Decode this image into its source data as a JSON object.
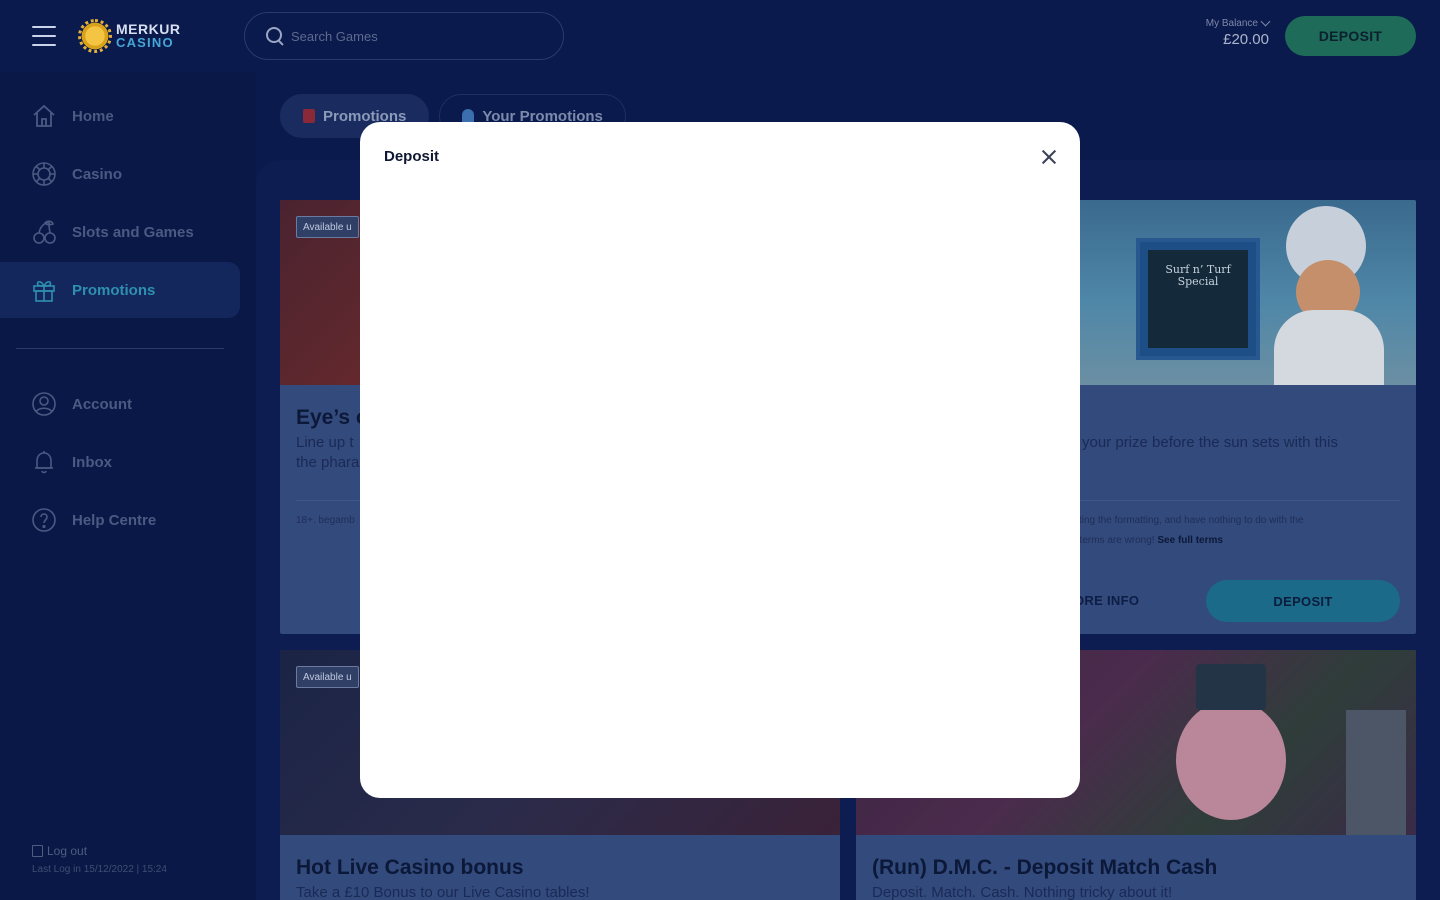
{
  "header": {
    "logo": {
      "line1": "MERKUR",
      "line2": "CASINO"
    },
    "search_placeholder": "Search Games",
    "balance_label": "My Balance",
    "balance_value": "£20.00",
    "deposit_label": "DEPOSIT"
  },
  "sidebar": {
    "items": [
      {
        "label": "Home",
        "icon": "home-icon"
      },
      {
        "label": "Casino",
        "icon": "roulette-icon"
      },
      {
        "label": "Slots and Games",
        "icon": "cherries-icon"
      },
      {
        "label": "Promotions",
        "icon": "gift-icon",
        "active": true
      },
      {
        "label": "Account",
        "icon": "user-icon"
      },
      {
        "label": "Inbox",
        "icon": "bell-icon"
      },
      {
        "label": "Help Centre",
        "icon": "help-icon"
      }
    ],
    "logout_label": "Log out",
    "last_login": "Last Log in 15/12/2022 | 15:24"
  },
  "tabs": [
    {
      "label": "Promotions",
      "active": true
    },
    {
      "label": "Your Promotions",
      "active": false
    }
  ],
  "cards": [
    {
      "badge": "Available u",
      "title": "Eye’s o",
      "desc_line1": "Line up t",
      "desc_line2": "the phara",
      "terms": "18+. begamb"
    },
    {
      "desc_line1": "your prize before the sun sets with this",
      "terms_line1": "sting the formatting, and have nothing to do with the",
      "terms_line2": "t terms are wrong!",
      "terms_link": "See full terms",
      "more_info": "ORE INFO",
      "deposit": "DEPOSIT",
      "image_text": [
        "Surf n’ Turf",
        "Special"
      ]
    },
    {
      "badge": "Available u",
      "title": "Hot Live Casino bonus",
      "desc_line1": "Take a £10 Bonus to our Live Casino tables!"
    },
    {
      "title": "(Run) D.M.C. - Deposit Match Cash",
      "desc_line1": "Deposit. Match. Cash. Nothing tricky about it!"
    }
  ],
  "modal": {
    "title": "Deposit"
  },
  "colors": {
    "background": "#0b1a4d",
    "accent": "#2f8fb0",
    "deposit_green": "#1d6b58",
    "modal_bg": "#ffffff"
  }
}
